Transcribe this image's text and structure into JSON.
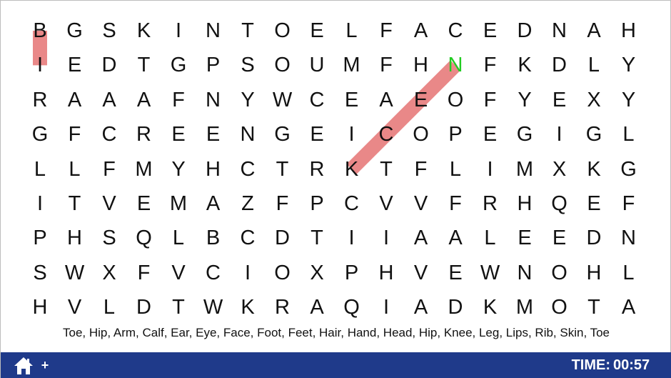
{
  "grid": [
    [
      "B",
      "G",
      "S",
      "K",
      "I",
      "N",
      "T",
      "O",
      "E",
      "L",
      "F",
      "A",
      "C",
      "E",
      "D",
      "N",
      "A",
      "H"
    ],
    [
      "I",
      "E",
      "D",
      "T",
      "G",
      "P",
      "S",
      "O",
      "U",
      "M",
      "F",
      "H",
      "N",
      "F",
      "K",
      "D",
      "L",
      "Y"
    ],
    [
      "R",
      "A",
      "A",
      "A",
      "F",
      "N",
      "Y",
      "W",
      "C",
      "E",
      "A",
      "E",
      "O",
      "F",
      "Y",
      "E",
      "X",
      "Y"
    ],
    [
      "G",
      "F",
      "C",
      "R",
      "E",
      "E",
      "N",
      "G",
      "E",
      "I",
      "C",
      "O",
      "P",
      "E",
      "G",
      "I",
      "G",
      "L"
    ],
    [
      "L",
      "L",
      "F",
      "M",
      "Y",
      "H",
      "C",
      "T",
      "R",
      "K",
      "T",
      "F",
      "L",
      "I",
      "M",
      "X",
      "K",
      "G"
    ],
    [
      "I",
      "T",
      "V",
      "E",
      "M",
      "A",
      "Z",
      "F",
      "P",
      "C",
      "V",
      "V",
      "F",
      "R",
      "H",
      "Q",
      "E",
      "F"
    ],
    [
      "P",
      "H",
      "S",
      "Q",
      "L",
      "B",
      "C",
      "D",
      "T",
      "I",
      "I",
      "A",
      "A",
      "L",
      "E",
      "E",
      "D",
      "N"
    ],
    [
      "S",
      "W",
      "X",
      "F",
      "V",
      "C",
      "I",
      "O",
      "X",
      "P",
      "H",
      "V",
      "E",
      "W",
      "N",
      "O",
      "H",
      "L"
    ],
    [
      "H",
      "V",
      "L",
      "D",
      "T",
      "W",
      "K",
      "R",
      "A",
      "Q",
      "I",
      "A",
      "D",
      "K",
      "M",
      "O",
      "T",
      "A"
    ]
  ],
  "highlights": [
    {
      "from": [
        0,
        0
      ],
      "to": [
        1,
        0
      ],
      "color": "#e57373"
    },
    {
      "from": [
        4,
        9
      ],
      "to": [
        1,
        12
      ],
      "color": "#e57373"
    }
  ],
  "current_cell": [
    1,
    12
  ],
  "current_cell_color": "#22cc22",
  "words": [
    "Toe",
    "Hip",
    "Arm",
    "Calf",
    "Ear",
    "Eye",
    "Face",
    "Foot",
    "Feet",
    "Hair",
    "Hand",
    "Head",
    "Hip",
    "Knee",
    "Leg",
    "Lips",
    "Rib",
    "Skin",
    "Toe"
  ],
  "word_list_text": "Toe, Hip, Arm, Calf, Ear, Eye, Face, Foot, Feet, Hair, Hand, Head, Hip, Knee, Leg, Lips, Rib, Skin, Toe",
  "footer": {
    "home_icon": "home-icon",
    "plus_label": "+",
    "timer_label": "TIME:",
    "timer_value": "00:57",
    "background": "#1f3a8a"
  }
}
